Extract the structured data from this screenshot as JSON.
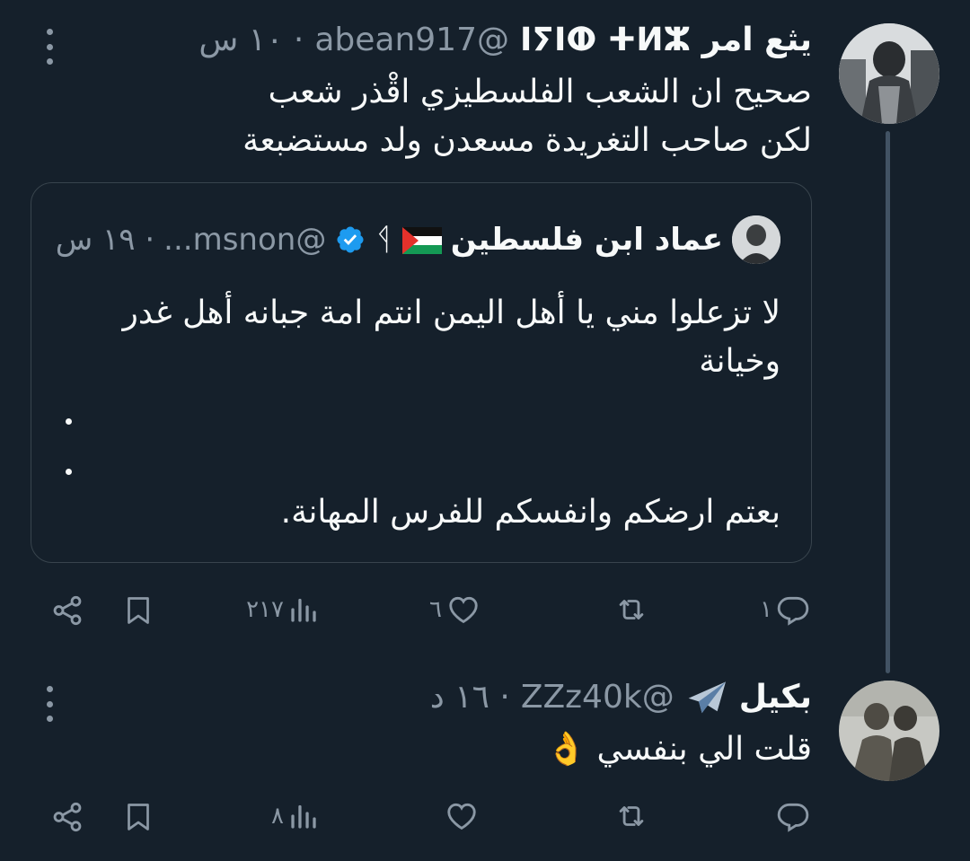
{
  "tweet1": {
    "name": "يثع امر ⵏⵢⵏⵀ ⵜⵍⵣ",
    "handle": "@abean917",
    "time": "· ١٠ س",
    "lines": [
      "صحيح ان الشعب الفلسطيزي اقْذر شعب",
      "لكن صاحب التغريدة مسعدن ولد مستضبعة"
    ],
    "actions": {
      "replies": "١",
      "retweets": "",
      "likes": "٦",
      "views": "٢١٧"
    }
  },
  "quote": {
    "name": "عماد ابن فلسطين",
    "extra_glyph": "ᛩ",
    "handle": "@msnon...",
    "time": "· ١٩ س",
    "line1": "لا تزعلوا مني يا أهل اليمن انتم امة جبانه أهل غدر",
    "line2": "وخيانة",
    "line3": "بعتم ارضكم وانفسكم للفرس المهانة."
  },
  "tweet2": {
    "name": "بكيل",
    "handle": "@ZZz40k",
    "time": "· ١٦ د",
    "line": "قلت الي بنفسي 👌",
    "actions": {
      "replies": "",
      "retweets": "",
      "likes": "",
      "views": "٨"
    }
  },
  "colors": {
    "background": "#15202b",
    "text": "#f7f9f9",
    "muted": "#8b98a5",
    "verified": "#1d9bf0",
    "border": "#38444d"
  },
  "icons": [
    "more-icon",
    "reply-icon",
    "retweet-icon",
    "like-icon",
    "views-icon",
    "bookmark-icon",
    "share-icon",
    "verified-icon",
    "airplane-icon",
    "palestine-flag-icon"
  ]
}
